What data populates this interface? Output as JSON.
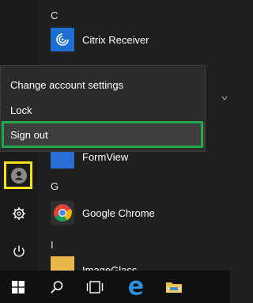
{
  "applist": {
    "groups": [
      {
        "letter": "C"
      },
      {
        "letter": "G"
      },
      {
        "letter": "I"
      }
    ],
    "apps": [
      {
        "label": "Citrix Receiver",
        "icon": "citrix-icon",
        "color": "#1c6fd1"
      },
      {
        "label": "FormView",
        "icon": "formview-icon",
        "color": "#2a6fd6"
      },
      {
        "label": "Google Chrome",
        "icon": "chrome-icon",
        "color": "#2f2f2f"
      },
      {
        "label": "ImageGlass",
        "icon": "imageglass-icon",
        "color": "#e8b84a"
      }
    ]
  },
  "account_menu": {
    "items": [
      {
        "label": "Change account settings"
      },
      {
        "label": "Lock"
      },
      {
        "label": "Sign out"
      }
    ],
    "highlighted": "Sign out"
  },
  "rail": {
    "icons": [
      "user-avatar-icon",
      "settings-gear-icon",
      "power-icon"
    ]
  },
  "taskbar": {
    "icons": [
      "windows-start-icon",
      "search-icon",
      "task-view-icon",
      "edge-icon",
      "file-explorer-icon"
    ]
  },
  "colors": {
    "green_frame": "#22a84a",
    "yellow_frame": "#f1e21c",
    "red_frame": "#e31b23"
  }
}
